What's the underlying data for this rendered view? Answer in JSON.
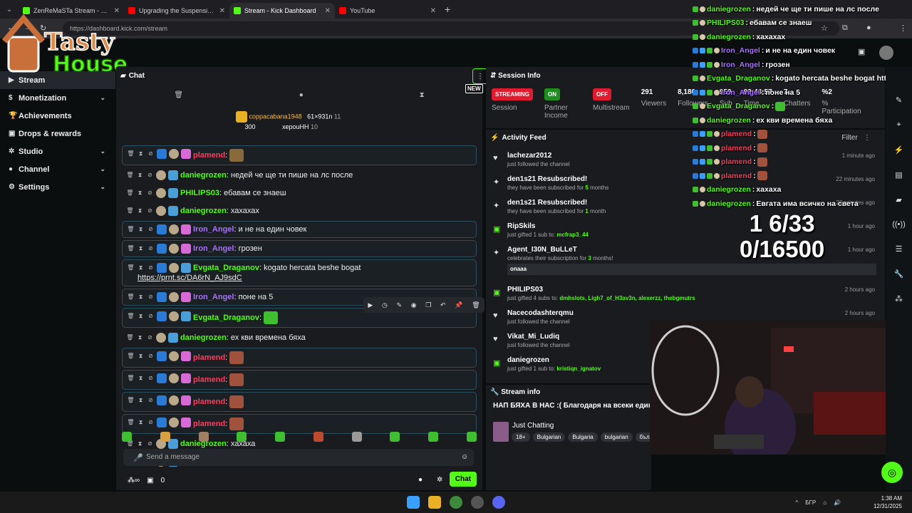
{
  "browser": {
    "tabs": [
      {
        "title": "ZenReMaSTa Stream - Watch Li",
        "color": "#53fc18"
      },
      {
        "title": "Upgrading the Suspension on M",
        "color": "#ff0000"
      },
      {
        "title": "Stream - Kick Dashboard",
        "color": "#53fc18",
        "active": true
      },
      {
        "title": "YouTube",
        "color": "#ff0000"
      }
    ],
    "url": "https://dashboard.kick.com/stream"
  },
  "logo": {
    "line1": "Tasty",
    "line2": "House"
  },
  "sidebar": {
    "items": [
      {
        "label": "Stream",
        "icon": "video-icon",
        "active": true
      },
      {
        "label": "Monetization",
        "icon": "dollar-icon",
        "chev": true
      },
      {
        "label": "Achievements",
        "icon": "trophy-icon"
      },
      {
        "label": "Drops & rewards",
        "icon": "gift-icon"
      },
      {
        "label": "Studio",
        "icon": "gear-icon",
        "chev": true
      },
      {
        "label": "Channel",
        "icon": "user-icon",
        "chev": true
      },
      {
        "label": "Settings",
        "icon": "settings-icon",
        "chev": true
      }
    ]
  },
  "chat": {
    "title": "Chat",
    "new_badge": "NEW",
    "gifters": {
      "first": {
        "name": "coppacabana1948",
        "count": "300"
      },
      "second": {
        "name": "61×931n",
        "count": "11"
      },
      "third": {
        "name": "хероuНН",
        "count": "10"
      }
    },
    "messages": [
      {
        "user": "plamend",
        "color": "#ff3b5c",
        "text": "",
        "emote": "#8a6a3a",
        "hl": true
      },
      {
        "user": "daniegrozen",
        "color": "#53fc18",
        "text": "недей че ще ти пише на лс после",
        "hl": false
      },
      {
        "user": "PHILIPS03",
        "color": "#53fc18",
        "text": "ебавам се знаеш",
        "hl": false
      },
      {
        "user": "daniegrozen",
        "color": "#53fc18",
        "text": "хахахах",
        "hl": false
      },
      {
        "user": "Iron_Angel",
        "color": "#a970ff",
        "text": "и не на един човек",
        "hl": true
      },
      {
        "user": "Iron_Angel",
        "color": "#a970ff",
        "text": "грозен",
        "hl": true
      },
      {
        "user": "Evgata_Draganov",
        "color": "#53fc18",
        "text": "kogato hercata beshe bogat",
        "text2": "https://prnt.sc/DA6rN_AJ9sdC",
        "hl": true
      },
      {
        "user": "Iron_Angel",
        "color": "#a970ff",
        "text": "поне на 5",
        "hl": true
      },
      {
        "user": "Evgata_Draganov",
        "color": "#53fc18",
        "text": "",
        "emote": "#3fbf2f",
        "hl": true
      },
      {
        "user": "daniegrozen",
        "color": "#53fc18",
        "text": "ех кви времена бяха",
        "hl": false
      },
      {
        "user": "plamend",
        "color": "#ff3b5c",
        "text": "",
        "emote": "#a0523d",
        "hl": true
      },
      {
        "user": "plamend",
        "color": "#ff3b5c",
        "text": "",
        "emote": "#a0523d",
        "hl": true
      },
      {
        "user": "plamend",
        "color": "#ff3b5c",
        "text": "",
        "emote": "#a0523d",
        "hl": true
      },
      {
        "user": "plamend",
        "color": "#ff3b5c",
        "text": "",
        "emote": "#a0523d",
        "hl": true
      },
      {
        "user": "daniegrozen",
        "color": "#53fc18",
        "text": "хахаха",
        "hl": false
      },
      {
        "user": "daniegrozen",
        "color": "#53fc18",
        "text": "Евгата има всичко на света",
        "hl": false
      }
    ],
    "placeholder": "Send a message",
    "count": "0",
    "send_label": "Chat"
  },
  "session": {
    "title": "Session Info",
    "stats": [
      {
        "value": "STREAMING",
        "label": "Session",
        "pill": "#e01b2f"
      },
      {
        "value": "ON",
        "label": "Partner Income",
        "pill": "#1e8f1e"
      },
      {
        "value": "OFF",
        "label": "Multistream",
        "pill": "#e01b2f"
      },
      {
        "value": "291",
        "label": "Viewers"
      },
      {
        "value": "8,180",
        "label": "Followers"
      },
      {
        "value": "959",
        "label": "Sub"
      },
      {
        "value": "03:44:57",
        "label": "Time"
      },
      {
        "value": "7",
        "label": "Chatters"
      },
      {
        "value": "%2",
        "label": "% Participation"
      }
    ]
  },
  "activity": {
    "title": "Activity Feed",
    "filter": "Filter",
    "items": [
      {
        "name": "lachezar2012",
        "desc": "just followed the channel",
        "time": "1 minute ago",
        "icon": "heart-icon"
      },
      {
        "name": "den1s21 Resubscribed!",
        "desc": "they have been subscribed for",
        "desc_b": "5",
        "desc2": "months",
        "time": "22 minutes ago",
        "icon": "star-icon"
      },
      {
        "name": "den1s21 Resubscribed!",
        "desc": "they have been subscribed for",
        "desc_b": "1",
        "desc2": "month",
        "time": "22 minutes ago",
        "icon": "star-icon"
      },
      {
        "name": "RipSkils",
        "desc": "just gifted 1 sub to:",
        "desc_b": "mcfrap3_44",
        "desc2": "",
        "time": "1 hour ago",
        "icon": "gift-icon"
      },
      {
        "name": "Agent_I30N_BuLLeT",
        "desc": "celebrates their subscription for",
        "desc_b": "3",
        "desc2": "months!",
        "time": "1 hour ago",
        "icon": "star-icon",
        "quote": "опааа"
      },
      {
        "name": "PHILIPS03",
        "desc": "just gifted 4 subs to:",
        "desc_b": "dmhslots, Ligh7_of_H3av3n, alexerzz, thebgmutrs",
        "desc2": "",
        "time": "2 hours ago",
        "icon": "gift-icon"
      },
      {
        "name": "Nacecodashterqmu",
        "desc": "just followed the channel",
        "time": "2 hours ago",
        "icon": "heart-icon"
      },
      {
        "name": "Vikat_Mi_Ludiq",
        "desc": "just followed the channel",
        "time": "",
        "icon": "heart-icon"
      },
      {
        "name": "daniegrozen",
        "desc": "just gifted 1 sub to:",
        "desc_b": "kristiqn_ignatov",
        "desc2": "",
        "time": "",
        "icon": "gift-icon"
      }
    ]
  },
  "stream_info": {
    "title": "Stream info",
    "stream_title": "НАП БЯХА В НАС :( Благодаря на всеки един",
    "category": "Just Chatting",
    "tags": [
      "18+",
      "Bulgarian",
      "Bulgaria",
      "bulgarian",
      "българ"
    ]
  },
  "overlay": {
    "rows": [
      {
        "user": "daniegrozen",
        "color": "#53fc18",
        "text": "недей че ще ти пише на лс после"
      },
      {
        "user": "PHILIPS03",
        "color": "#53fc18",
        "text": "ебавам се знаеш"
      },
      {
        "user": "daniegrozen",
        "color": "#53fc18",
        "text": "хахахах"
      },
      {
        "user": "Iron_Angel",
        "color": "#a970ff",
        "text": "и не на един човек"
      },
      {
        "user": "Iron_Angel",
        "color": "#a970ff",
        "text": "грозен"
      },
      {
        "user": "Evgata_Draganov",
        "color": "#53fc18",
        "text": "kogato hercata beshe bogat https://prnt"
      },
      {
        "user": "Iron_Angel",
        "color": "#a970ff",
        "text": "поне на 5"
      },
      {
        "user": "Evgata_Draganov",
        "color": "#53fc18",
        "text": ""
      },
      {
        "user": "daniegrozen",
        "color": "#53fc18",
        "text": "ех кви времена бяха"
      },
      {
        "user": "plamend",
        "color": "#ff3b5c",
        "text": ""
      },
      {
        "user": "plamend",
        "color": "#ff3b5c",
        "text": ""
      },
      {
        "user": "plamend",
        "color": "#ff3b5c",
        "text": ""
      },
      {
        "user": "plamend",
        "color": "#ff3b5c",
        "text": ""
      },
      {
        "user": "daniegrozen",
        "color": "#53fc18",
        "text": "хахаха"
      },
      {
        "user": "daniegrozen",
        "color": "#53fc18",
        "text": "Евгата има всичко на света"
      }
    ],
    "counter1": "1 6/33",
    "counter2": "0/16500"
  },
  "taskbar": {
    "lang": "БГР",
    "time": "1:38 AM",
    "date": "12/31/2025"
  }
}
